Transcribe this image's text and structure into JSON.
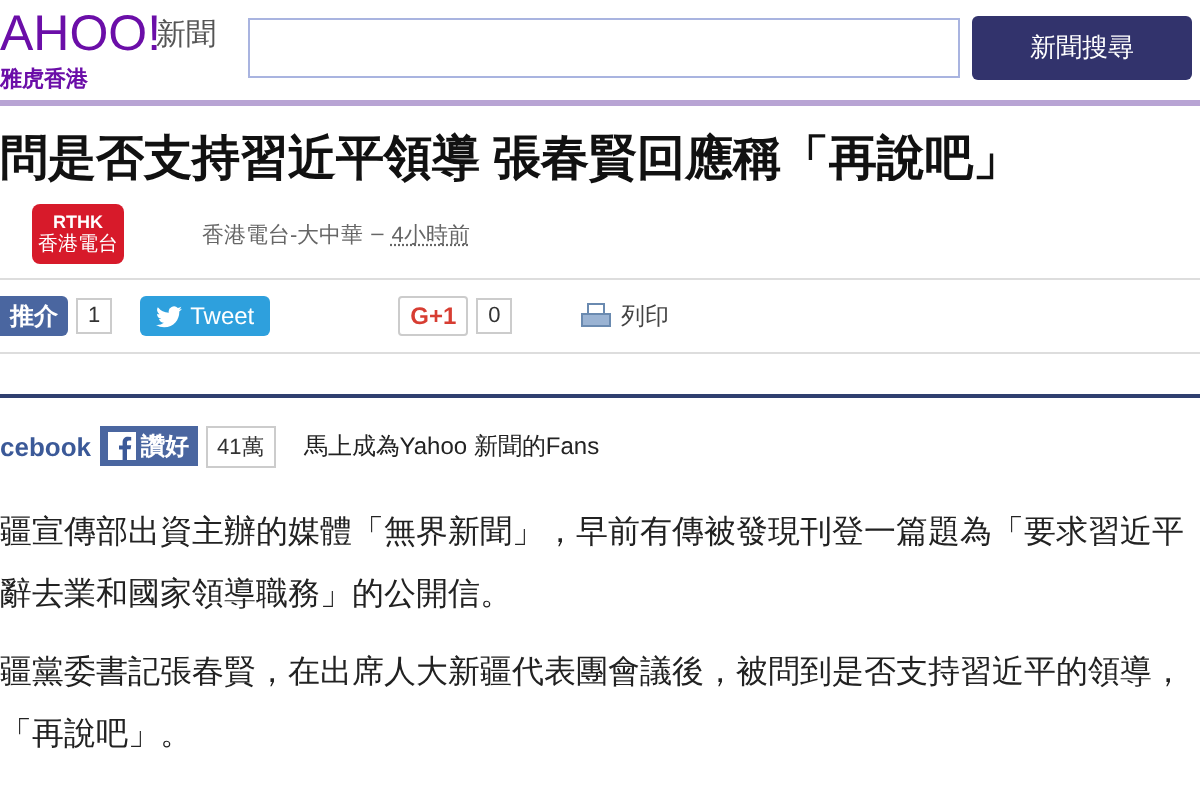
{
  "header": {
    "logo": "AHOO!",
    "logo_sub": "雅虎香港",
    "section": "新聞",
    "search_button": "新聞搜尋"
  },
  "article": {
    "headline": "問是否支持習近平領導 張春賢回應稱「再說吧」",
    "source_logo": {
      "top": "RTHK",
      "bottom": "香港電台"
    },
    "source": "香港電台-大中華",
    "separator": "–",
    "time": "4小時前",
    "share": [
      {
        "kind": "facebook",
        "label": "推介",
        "count": "1"
      },
      {
        "kind": "twitter",
        "label": "Tweet"
      },
      {
        "kind": "gplus",
        "label": "G+1",
        "count": "0"
      },
      {
        "kind": "print",
        "label": "列印"
      }
    ],
    "fan_bar": {
      "brand": "cebook",
      "like": "讚好",
      "count": "41萬",
      "text": "馬上成為Yahoo 新聞的Fans"
    },
    "paragraphs": [
      [
        "疆宣傳部出資主辦的媒體「無界新聞」，早前有傳被發現刊登一篇題為「要求習近平",
        "辭去業和國家領導職務」的公開信。"
      ],
      [
        "疆黨委書記張春賢，在出席人大新疆代表團會議後，被問到是否支持習近平的領導，",
        "「再說吧」。"
      ]
    ]
  }
}
